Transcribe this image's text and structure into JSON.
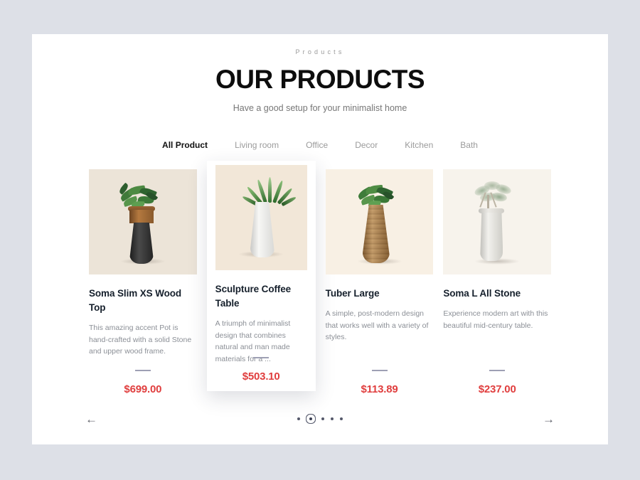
{
  "header": {
    "eyebrow": "Products",
    "title": "OUR PRODUCTS",
    "subtitle": "Have a good setup for your minimalist home"
  },
  "tabs": [
    {
      "label": "All Product",
      "active": true
    },
    {
      "label": "Living room",
      "active": false
    },
    {
      "label": "Office",
      "active": false
    },
    {
      "label": "Decor",
      "active": false
    },
    {
      "label": "Kitchen",
      "active": false
    },
    {
      "label": "Bath",
      "active": false
    }
  ],
  "products": [
    {
      "name": "Soma Slim XS Wood Top",
      "description": "This amazing accent Pot is hand-crafted with a solid Stone and upper wood frame.",
      "price": "$699.00",
      "featured": false,
      "image_bg": "#ece4d8"
    },
    {
      "name": "Sculpture Coffee Table",
      "description": "A triumph of minimalist design that combines natural and man made materials for a ...",
      "price": "$503.10",
      "featured": true,
      "image_bg": "#f2e7d8"
    },
    {
      "name": "Tuber Large",
      "description": "A simple, post-modern design that works well with a variety of styles.",
      "price": "$113.89",
      "featured": false,
      "image_bg": "#f8f0e4"
    },
    {
      "name": "Soma L All Stone",
      "description": "Experience modern art with this beautiful mid-century table.",
      "price": "$237.00",
      "featured": false,
      "image_bg": "#f7f3ec"
    }
  ],
  "footer": {
    "prev_icon": "←",
    "next_icon": "→",
    "dots_total": 5,
    "active_dot_index": 1
  },
  "colors": {
    "price": "#e03e3e",
    "title": "#0d0d0d",
    "muted": "#8b8f96",
    "page_bg": "#dde0e7"
  }
}
